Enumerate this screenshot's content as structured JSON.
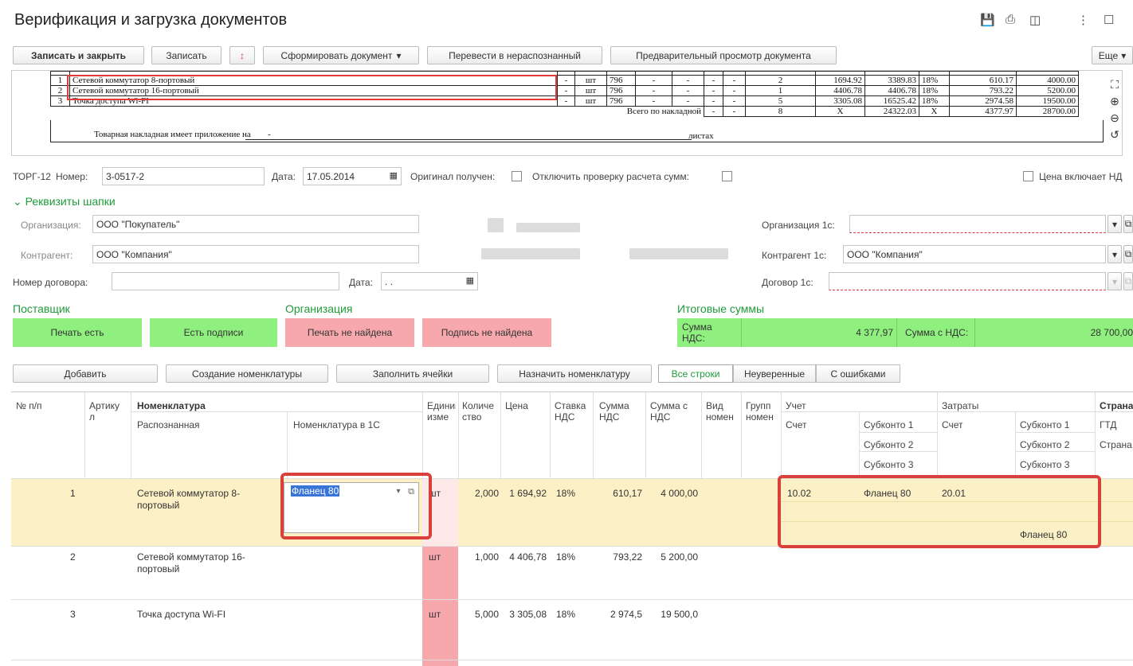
{
  "window": {
    "title": "Верификация и загрузка документов",
    "icons": [
      "save-icon",
      "print-icon",
      "preview-icon",
      "more-icon",
      "maximize-icon"
    ]
  },
  "toolbar": {
    "save_close": "Записать и закрыть",
    "save": "Записать",
    "form_doc": "Сформировать документ",
    "to_unrecognized": "Перевести в нераспознанный",
    "preview": "Предварительный просмотр документа",
    "more": "Еще"
  },
  "scan": {
    "rows": [
      {
        "n": "1",
        "name": "Сетевой коммутатор 8-портовый",
        "dash": "-",
        "unit": "шт",
        "code": "796",
        "qty": "2",
        "price": "1694.92",
        "sum": "3389.83",
        "vat": "18%",
        "vat_sum": "610.17",
        "total": "4000.00"
      },
      {
        "n": "2",
        "name": "Сетевой коммутатор 16-портовый",
        "dash": "-",
        "unit": "шт",
        "code": "796",
        "qty": "1",
        "price": "4406.78",
        "sum": "4406.78",
        "vat": "18%",
        "vat_sum": "793.22",
        "total": "5200.00"
      },
      {
        "n": "3",
        "name": "Точка доступа Wi-FI",
        "dash": "-",
        "unit": "шт",
        "code": "796",
        "qty": "5",
        "price": "3305.08",
        "sum": "16525.42",
        "vat": "18%",
        "vat_sum": "2974.58",
        "total": "19500.00"
      }
    ],
    "total_label": "Всего по накладной",
    "total_qty": "8",
    "total_x": "X",
    "total_sum": "24322.03",
    "total_vat": "4377.97",
    "total_all": "28700.00",
    "appendix": "Товарная накладная имеет приложение на",
    "appendix_value": "-",
    "sheets": "листах"
  },
  "header": {
    "doc_type": "ТОРГ-12",
    "number_label": "Номер:",
    "number": "3-0517-2",
    "date_label": "Дата:",
    "date": "17.05.2014",
    "original_label": "Оригинал получен:",
    "disable_check_label": "Отключить проверку расчета сумм:",
    "price_incl_vat": "Цена включает НД"
  },
  "requisites": {
    "section": "Реквизиты шапки",
    "org_label": "Организация:",
    "org_value": "ООО \"Покупатель\"",
    "contractor_label": "Контрагент:",
    "contractor_value": "ООО \"Компания\"",
    "contract_label": "Номер договора:",
    "contract_date_label": "Дата:",
    "contract_date": " .  .",
    "org1c_label": "Организация 1с:",
    "org1c_value": "",
    "contractor1c_label": "Контрагент 1с:",
    "contractor1c_value": "ООО \"Компания\"",
    "contract1c_label": "Договор 1с:",
    "contract1c_value": ""
  },
  "status": {
    "supplier": "Поставщик",
    "organization": "Организация",
    "totals": "Итоговые суммы",
    "stamp_ok": "Печать есть",
    "sign_ok": "Есть подписи",
    "stamp_missing": "Печать не найдена",
    "sign_missing": "Подпись не найдена",
    "vat_sum_label": "Сумма НДС:",
    "vat_sum_value": "4 377,97",
    "total_vat_label": "Сумма с НДС:",
    "total_vat_value": "28 700,00"
  },
  "actions": {
    "add": "Добавить",
    "create_nom": "Создание номенклатуры",
    "fill_cells": "Заполнить ячейки",
    "assign_nom": "Назначить номенклатуру",
    "tab_all": "Все строки",
    "tab_uncertain": "Неуверенные",
    "tab_errors": "С ошибками"
  },
  "grid": {
    "headers": {
      "num": "№ п/п",
      "article": "Артикул",
      "nomenclature": "Номенклатура",
      "recognized": "Распознанная",
      "nom_1c": "Номенклатура в 1С",
      "unit": "Единица изме",
      "qty": "Количество",
      "price": "Цена",
      "vat_rate": "Ставка НДС",
      "vat_sum": "Сумма НДС",
      "sum_vat": "Сумма с НДС",
      "nom_kind": "Вид номен",
      "nom_group": "Групп номен",
      "account": "Учет",
      "acc": "Счет",
      "sub1": "Субконто 1",
      "sub2": "Субконто 2",
      "sub3": "Субконто 3",
      "costs": "Затраты",
      "cost_acc": "Счет",
      "cost_sub1": "Субконто 1",
      "cost_sub2": "Субконто 2",
      "cost_sub3": "Субконто 3",
      "country": "Страна",
      "gtd": "ГТД",
      "country2": "Страна"
    },
    "rows": [
      {
        "n": "1",
        "name": "Сетевой коммутатор 8-портовый",
        "nom1c": "Фланец 80",
        "unit": "шт",
        "qty": "2,000",
        "price": "1 694,92",
        "vat": "18%",
        "vat_sum": "610,17",
        "total": "4 000,00",
        "acc": "10.02",
        "sub1": "Фланец 80",
        "cost_acc": "20.01",
        "cost_sub3": "Фланец 80"
      },
      {
        "n": "2",
        "name": "Сетевой коммутатор 16-портовый",
        "unit": "шт",
        "qty": "1,000",
        "price": "4 406,78",
        "vat": "18%",
        "vat_sum": "793,22",
        "total": "5 200,00"
      },
      {
        "n": "3",
        "name": "Точка доступа Wi-FI",
        "unit": "шт",
        "qty": "5,000",
        "price": "3 305,08",
        "vat": "18%",
        "vat_sum": "2 974,5",
        "total": "19 500,0"
      }
    ]
  },
  "colors": {
    "accent_green": "#1f9b3a",
    "ok_plate": "#8ff07f",
    "error_plate": "#f6a8ad",
    "selected_row": "#fcf0c6",
    "highlight_red": "#d9403a"
  }
}
